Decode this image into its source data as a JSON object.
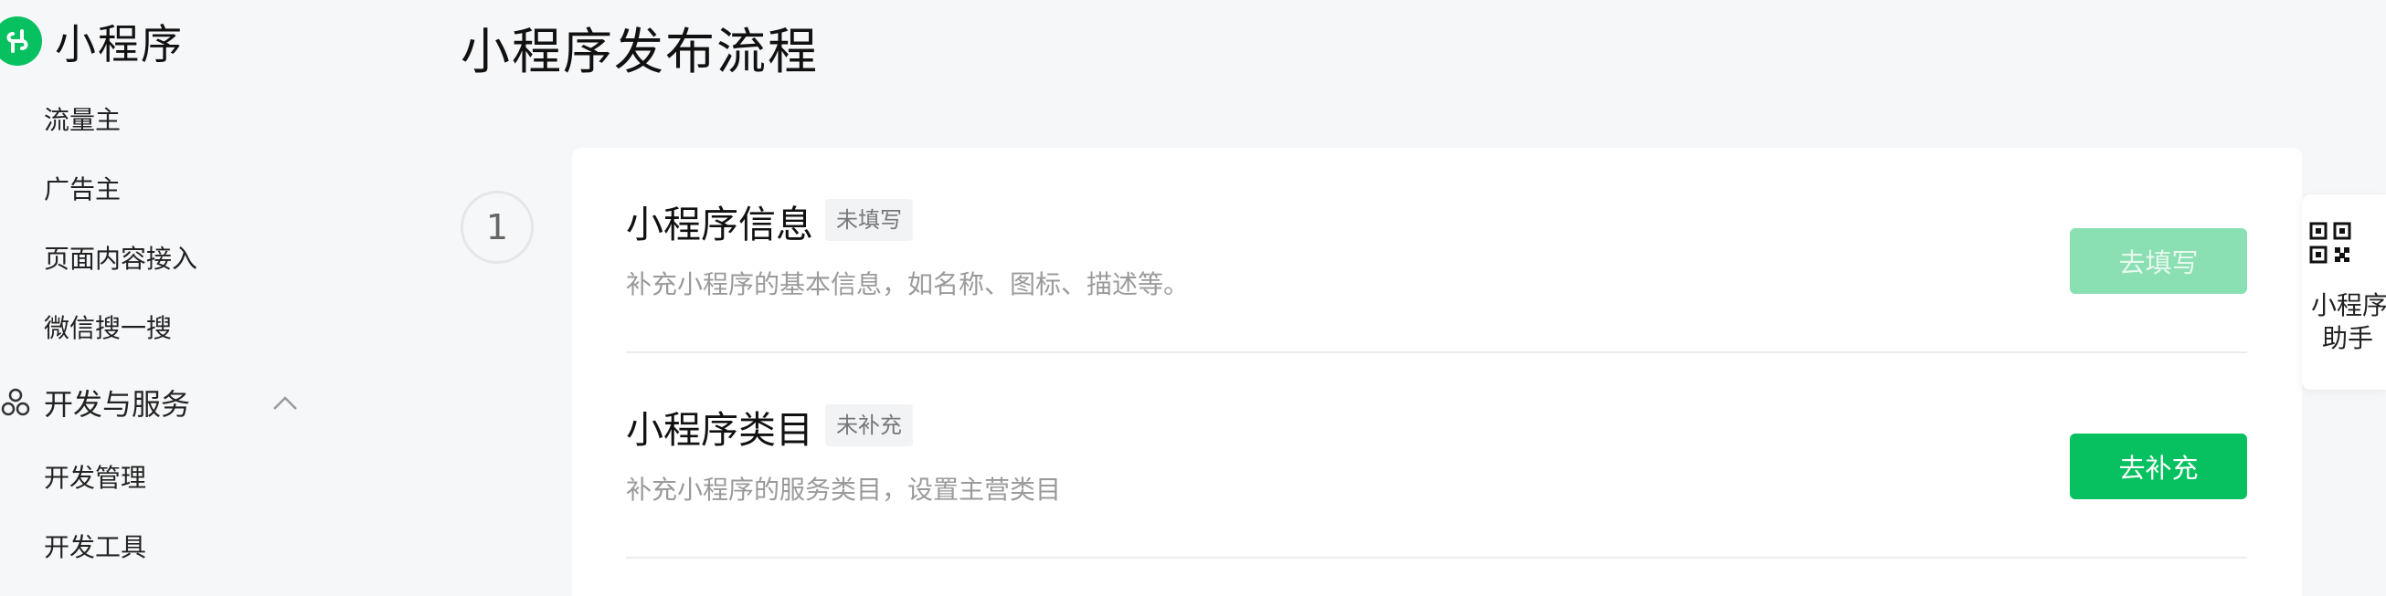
{
  "brand": {
    "title": "小程序",
    "logo_icon": "miniprogram-logo-icon"
  },
  "sidebar": {
    "items_top": [
      {
        "label": "流量主"
      },
      {
        "label": "广告主"
      },
      {
        "label": "页面内容接入"
      },
      {
        "label": "微信搜一搜"
      }
    ],
    "group": {
      "label": "开发与服务",
      "icon": "hexagon-cluster-icon",
      "expanded": true
    },
    "items_group": [
      {
        "label": "开发管理"
      },
      {
        "label": "开发工具"
      }
    ]
  },
  "main": {
    "title": "小程序发布流程",
    "step_number": "1",
    "rows": [
      {
        "title": "小程序信息",
        "tag": "未填写",
        "desc": "补充小程序的基本信息，如名称、图标、描述等。",
        "button": "去填写",
        "button_state": "disabled"
      },
      {
        "title": "小程序类目",
        "tag": "未补充",
        "desc": "补充小程序的服务类目，设置主营类目",
        "button": "去补充",
        "button_state": "primary"
      }
    ]
  },
  "helper": {
    "label_line1": "小程序",
    "label_line2": "助手",
    "icon": "qr-code-icon"
  },
  "colors": {
    "brand_green": "#07c160",
    "disabled_green": "#8ae0b3",
    "bg": "#f6f7f9"
  }
}
